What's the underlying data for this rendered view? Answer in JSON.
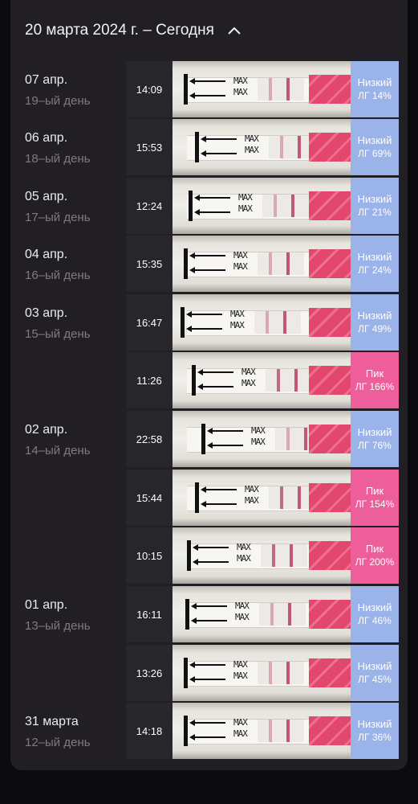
{
  "header": {
    "title": "20 марта 2024 г. – Сегодня"
  },
  "icons": {
    "collapse": "chevron-up-icon"
  },
  "colors": {
    "low": "#9ab3e8",
    "peak": "#ed5e9a",
    "card": "#221f24"
  },
  "groups": [
    {
      "date": "07 апр.",
      "day": "19–ый день"
    },
    {
      "date": "06 апр.",
      "day": "18–ый день"
    },
    {
      "date": "05 апр.",
      "day": "17–ый день"
    },
    {
      "date": "04 апр.",
      "day": "16–ый день"
    },
    {
      "date": "03 апр.",
      "day": "15–ый день"
    },
    {
      "date": "02 апр.",
      "day": "14–ый день"
    },
    {
      "date": "01 апр.",
      "day": "13–ый день"
    },
    {
      "date": "31 марта",
      "day": "12–ый день"
    }
  ],
  "tests": [
    {
      "time": "14:09",
      "level": "Низкий",
      "lh": "ЛГ 14%",
      "type": "low"
    },
    {
      "time": "15:53",
      "level": "Низкий",
      "lh": "ЛГ 69%",
      "type": "low"
    },
    {
      "time": "12:24",
      "level": "Низкий",
      "lh": "ЛГ 21%",
      "type": "low"
    },
    {
      "time": "15:35",
      "level": "Низкий",
      "lh": "ЛГ 24%",
      "type": "low"
    },
    {
      "time": "16:47",
      "level": "Низкий",
      "lh": "ЛГ 49%",
      "type": "low"
    },
    {
      "time": "11:26",
      "level": "Пик",
      "lh": "ЛГ 166%",
      "type": "peak"
    },
    {
      "time": "22:58",
      "level": "Низкий",
      "lh": "ЛГ 76%",
      "type": "low"
    },
    {
      "time": "15:44",
      "level": "Пик",
      "lh": "ЛГ 154%",
      "type": "peak"
    },
    {
      "time": "10:15",
      "level": "Пик",
      "lh": "ЛГ 200%",
      "type": "peak"
    },
    {
      "time": "16:11",
      "level": "Низкий",
      "lh": "ЛГ 46%",
      "type": "low"
    },
    {
      "time": "13:26",
      "level": "Низкий",
      "lh": "ЛГ 45%",
      "type": "low"
    },
    {
      "time": "14:18",
      "level": "Низкий",
      "lh": "ЛГ 36%",
      "type": "low"
    }
  ],
  "strip_text": "MAX"
}
